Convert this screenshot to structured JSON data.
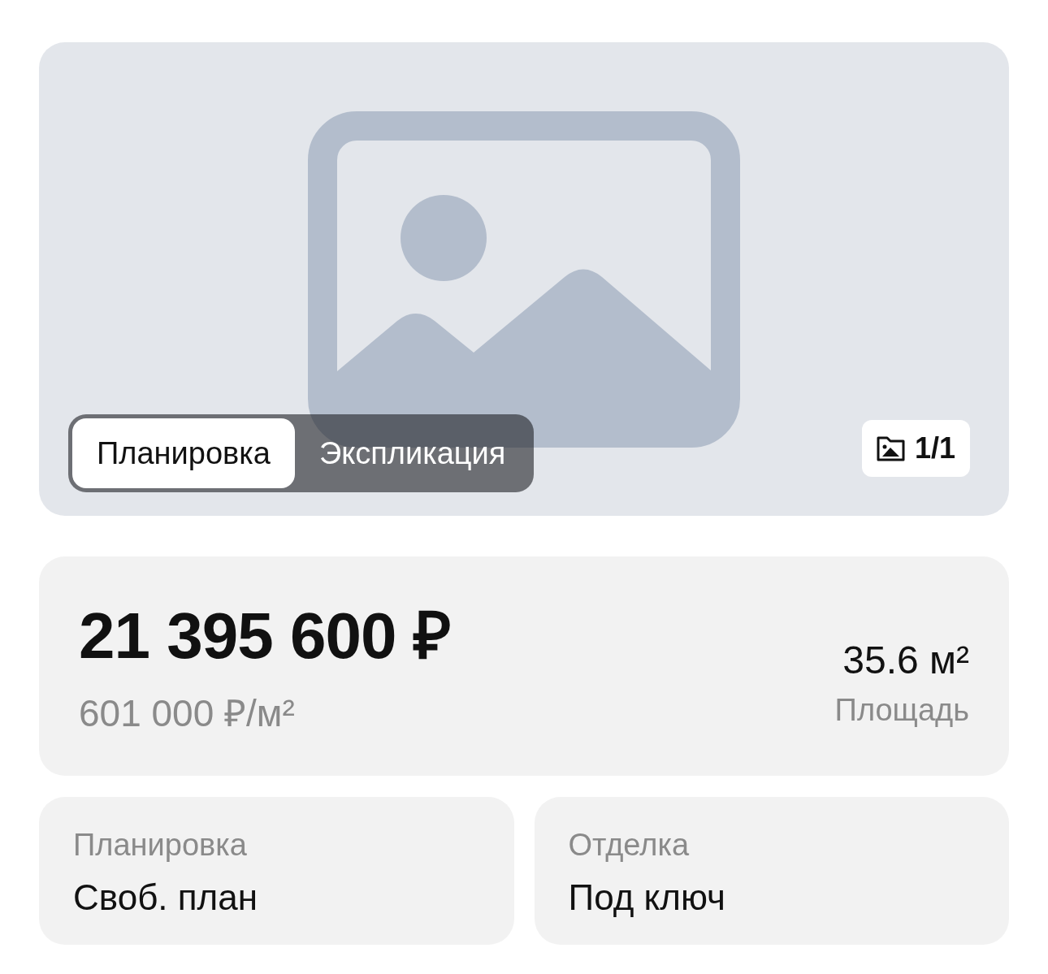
{
  "gallery": {
    "tabs": [
      {
        "label": "Планировка",
        "selected": true
      },
      {
        "label": "Экспликация",
        "selected": false
      }
    ],
    "counter": "1/1"
  },
  "price": {
    "total": "21 395 600 ₽",
    "per_m2": "601 000 ₽/м²"
  },
  "area": {
    "value": "35.6 м²",
    "label": "Площадь"
  },
  "details": [
    {
      "label": "Планировка",
      "value": "Своб. план"
    },
    {
      "label": "Отделка",
      "value": "Под ключ"
    }
  ]
}
